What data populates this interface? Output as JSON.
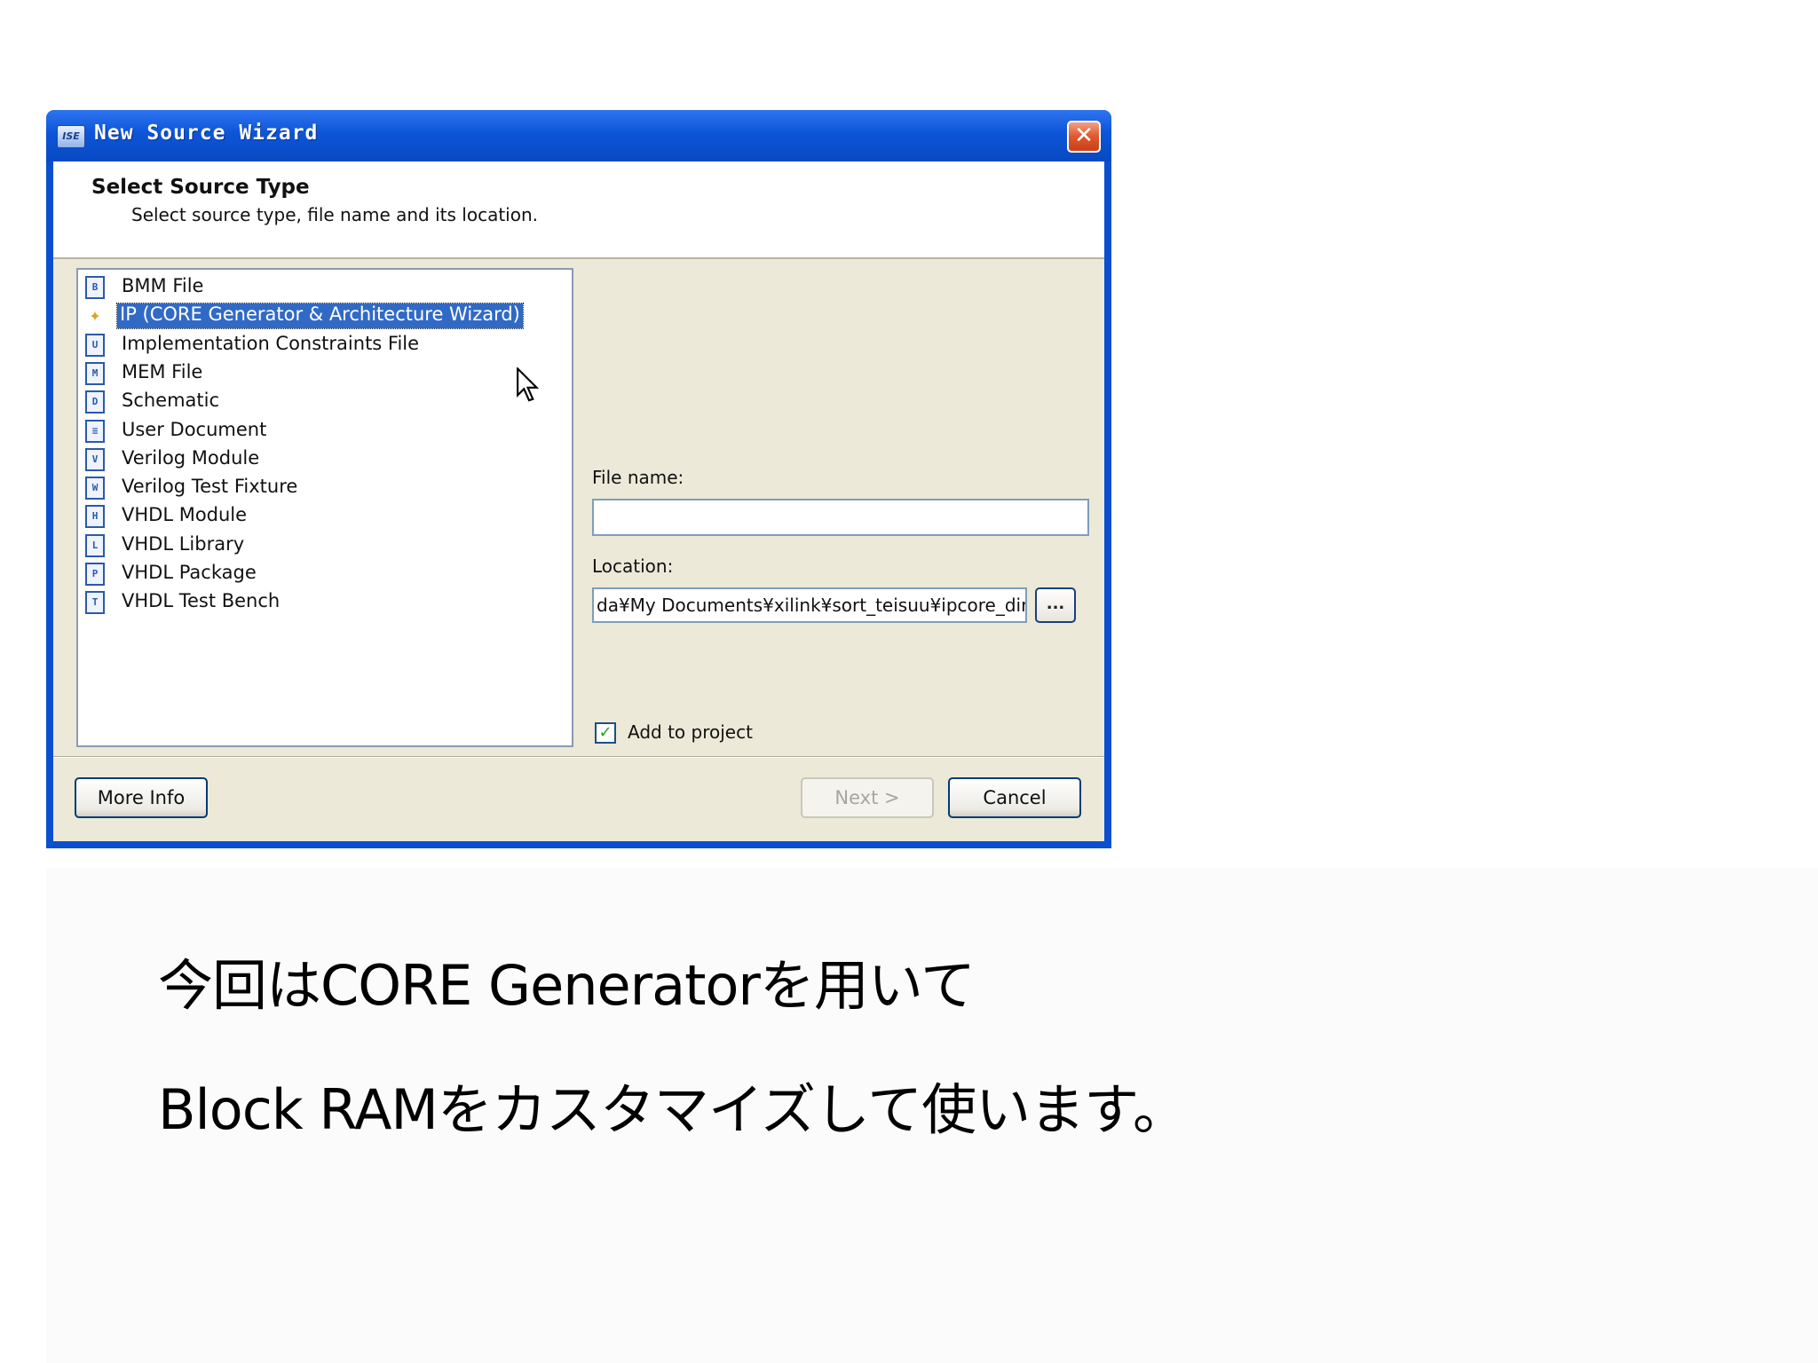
{
  "window": {
    "title": "New Source Wizard",
    "app_icon_text": "ISE",
    "close_glyph": "✕"
  },
  "header": {
    "title": "Select Source Type",
    "subtitle": "Select source type, file name and its location."
  },
  "source_types": [
    {
      "label": "BMM File",
      "icon": "bmm-file-icon",
      "glyph": "B"
    },
    {
      "label": "IP (CORE Generator & Architecture Wizard)",
      "icon": "ip-core-icon",
      "glyph": "✦",
      "selected": true
    },
    {
      "label": "Implementation Constraints File",
      "icon": "constraints-file-icon",
      "glyph": "U"
    },
    {
      "label": "MEM File",
      "icon": "mem-file-icon",
      "glyph": "M"
    },
    {
      "label": "Schematic",
      "icon": "schematic-icon",
      "glyph": "D"
    },
    {
      "label": "User Document",
      "icon": "document-icon",
      "glyph": "≡"
    },
    {
      "label": "Verilog Module",
      "icon": "verilog-module-icon",
      "glyph": "V"
    },
    {
      "label": "Verilog Test Fixture",
      "icon": "verilog-test-fixture-icon",
      "glyph": "W"
    },
    {
      "label": "VHDL Module",
      "icon": "vhdl-module-icon",
      "glyph": "H"
    },
    {
      "label": "VHDL Library",
      "icon": "vhdl-library-icon",
      "glyph": "L"
    },
    {
      "label": "VHDL Package",
      "icon": "vhdl-package-icon",
      "glyph": "P"
    },
    {
      "label": "VHDL Test Bench",
      "icon": "vhdl-test-bench-icon",
      "glyph": "T"
    }
  ],
  "form": {
    "file_name_label": "File name:",
    "file_name_value": "",
    "location_label": "Location:",
    "location_value": "da¥My Documents¥xilink¥sort_teisuu¥ipcore_dir",
    "browse_label": "...",
    "add_to_project_label": "Add to project",
    "add_to_project_checked": true,
    "check_glyph": "✓"
  },
  "buttons": {
    "more_info": "More Info",
    "next": "Next >",
    "cancel": "Cancel"
  },
  "caption": {
    "line1": "今回はCORE Generatorを用いて",
    "line2": "Block RAMをカスタマイズして使います。"
  },
  "colors": {
    "selection": "#316ac5",
    "titlebar": "#0d55d8",
    "dialog_face": "#ece9d8"
  }
}
